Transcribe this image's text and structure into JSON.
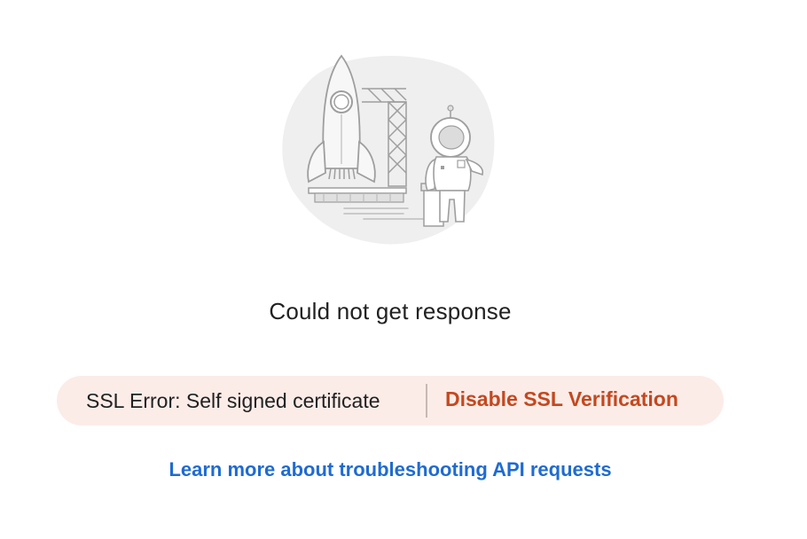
{
  "response": {
    "title": "Could not get response"
  },
  "ssl": {
    "error_text": "SSL Error: Self signed certificate",
    "action_label": "Disable SSL Verification"
  },
  "help": {
    "link_text": "Learn more about troubleshooting API requests"
  },
  "colors": {
    "error_pill_bg": "#fbece8",
    "action_color": "#c4481f",
    "link_color": "#1f6bd1"
  },
  "icons": {
    "illustration": "rocket-astronaut-illustration"
  }
}
